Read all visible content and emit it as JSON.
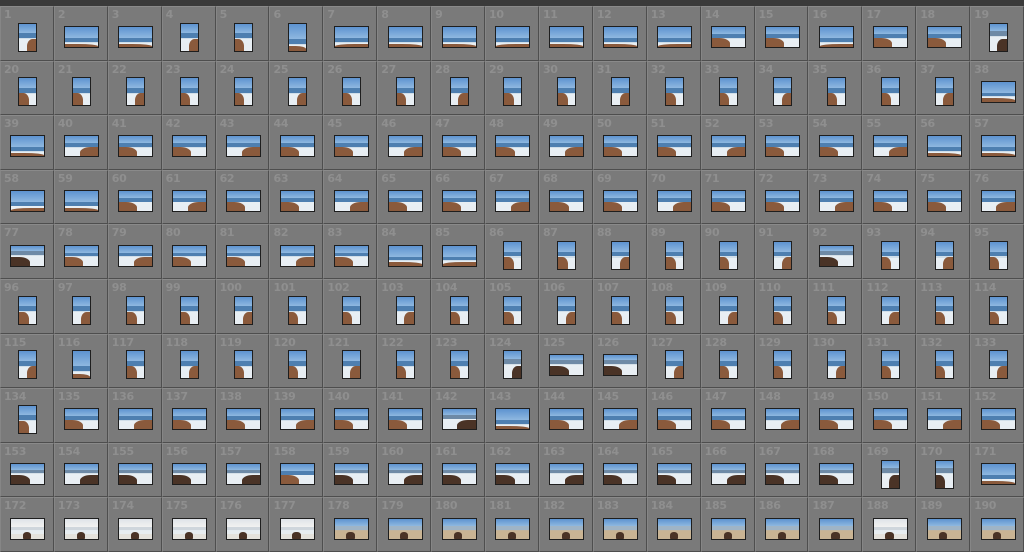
{
  "grid": {
    "columns": 19,
    "rows": 10,
    "first_number": 1,
    "last_number": 190,
    "thumbnails": [
      {
        "n": 1,
        "o": "portrait",
        "s": "coast"
      },
      {
        "n": 2,
        "o": "landscape",
        "s": "ocean"
      },
      {
        "n": 3,
        "o": "landscape",
        "s": "ocean"
      },
      {
        "n": 4,
        "o": "portrait",
        "s": "coast"
      },
      {
        "n": 5,
        "o": "portrait",
        "s": "coast"
      },
      {
        "n": 6,
        "o": "portrait",
        "s": "ocean"
      },
      {
        "n": 7,
        "o": "landscape",
        "s": "ocean"
      },
      {
        "n": 8,
        "o": "landscape",
        "s": "ocean"
      },
      {
        "n": 9,
        "o": "landscape",
        "s": "ocean"
      },
      {
        "n": 10,
        "o": "landscape",
        "s": "ocean"
      },
      {
        "n": 11,
        "o": "landscape",
        "s": "ocean"
      },
      {
        "n": 12,
        "o": "landscape",
        "s": "ocean"
      },
      {
        "n": 13,
        "o": "landscape",
        "s": "ocean"
      },
      {
        "n": 14,
        "o": "landscape",
        "s": "coast"
      },
      {
        "n": 15,
        "o": "landscape",
        "s": "coast"
      },
      {
        "n": 16,
        "o": "landscape",
        "s": "ocean"
      },
      {
        "n": 17,
        "o": "landscape",
        "s": "coast"
      },
      {
        "n": 18,
        "o": "landscape",
        "s": "coast"
      },
      {
        "n": 19,
        "o": "portrait",
        "s": "dark"
      },
      {
        "n": 20,
        "o": "portrait",
        "s": "coast"
      },
      {
        "n": 21,
        "o": "portrait",
        "s": "coast"
      },
      {
        "n": 22,
        "o": "portrait",
        "s": "coast"
      },
      {
        "n": 23,
        "o": "portrait",
        "s": "coast"
      },
      {
        "n": 24,
        "o": "portrait",
        "s": "coast"
      },
      {
        "n": 25,
        "o": "portrait",
        "s": "coast"
      },
      {
        "n": 26,
        "o": "portrait",
        "s": "coast"
      },
      {
        "n": 27,
        "o": "portrait",
        "s": "coast"
      },
      {
        "n": 28,
        "o": "portrait",
        "s": "coast"
      },
      {
        "n": 29,
        "o": "portrait",
        "s": "coast"
      },
      {
        "n": 30,
        "o": "portrait",
        "s": "coast"
      },
      {
        "n": 31,
        "o": "portrait",
        "s": "coast"
      },
      {
        "n": 32,
        "o": "portrait",
        "s": "coast"
      },
      {
        "n": 33,
        "o": "portrait",
        "s": "coast"
      },
      {
        "n": 34,
        "o": "portrait",
        "s": "coast"
      },
      {
        "n": 35,
        "o": "portrait",
        "s": "coast"
      },
      {
        "n": 36,
        "o": "portrait",
        "s": "coast"
      },
      {
        "n": 37,
        "o": "portrait",
        "s": "coast"
      },
      {
        "n": 38,
        "o": "landscape",
        "s": "ocean"
      },
      {
        "n": 39,
        "o": "landscape",
        "s": "ocean"
      },
      {
        "n": 40,
        "o": "landscape",
        "s": "coast"
      },
      {
        "n": 41,
        "o": "landscape",
        "s": "coast"
      },
      {
        "n": 42,
        "o": "landscape",
        "s": "coast"
      },
      {
        "n": 43,
        "o": "landscape",
        "s": "coast"
      },
      {
        "n": 44,
        "o": "landscape",
        "s": "coast"
      },
      {
        "n": 45,
        "o": "landscape",
        "s": "coast"
      },
      {
        "n": 46,
        "o": "landscape",
        "s": "coast"
      },
      {
        "n": 47,
        "o": "landscape",
        "s": "coast"
      },
      {
        "n": 48,
        "o": "landscape",
        "s": "coast"
      },
      {
        "n": 49,
        "o": "landscape",
        "s": "coast"
      },
      {
        "n": 50,
        "o": "landscape",
        "s": "coast"
      },
      {
        "n": 51,
        "o": "landscape",
        "s": "coast"
      },
      {
        "n": 52,
        "o": "landscape",
        "s": "coast"
      },
      {
        "n": 53,
        "o": "landscape",
        "s": "coast"
      },
      {
        "n": 54,
        "o": "landscape",
        "s": "coast"
      },
      {
        "n": 55,
        "o": "landscape",
        "s": "coast"
      },
      {
        "n": 56,
        "o": "landscape",
        "s": "ocean"
      },
      {
        "n": 57,
        "o": "landscape",
        "s": "ocean"
      },
      {
        "n": 58,
        "o": "landscape",
        "s": "ocean"
      },
      {
        "n": 59,
        "o": "landscape",
        "s": "ocean"
      },
      {
        "n": 60,
        "o": "landscape",
        "s": "coast"
      },
      {
        "n": 61,
        "o": "landscape",
        "s": "coast"
      },
      {
        "n": 62,
        "o": "landscape",
        "s": "coast"
      },
      {
        "n": 63,
        "o": "landscape",
        "s": "coast"
      },
      {
        "n": 64,
        "o": "landscape",
        "s": "coast"
      },
      {
        "n": 65,
        "o": "landscape",
        "s": "coast"
      },
      {
        "n": 66,
        "o": "landscape",
        "s": "coast"
      },
      {
        "n": 67,
        "o": "landscape",
        "s": "coast"
      },
      {
        "n": 68,
        "o": "landscape",
        "s": "coast"
      },
      {
        "n": 69,
        "o": "landscape",
        "s": "coast"
      },
      {
        "n": 70,
        "o": "landscape",
        "s": "coast"
      },
      {
        "n": 71,
        "o": "landscape",
        "s": "coast"
      },
      {
        "n": 72,
        "o": "landscape",
        "s": "coast"
      },
      {
        "n": 73,
        "o": "landscape",
        "s": "coast"
      },
      {
        "n": 74,
        "o": "landscape",
        "s": "coast"
      },
      {
        "n": 75,
        "o": "landscape",
        "s": "coast"
      },
      {
        "n": 76,
        "o": "landscape",
        "s": "coast"
      },
      {
        "n": 77,
        "o": "landscape",
        "s": "dark"
      },
      {
        "n": 78,
        "o": "landscape",
        "s": "coast"
      },
      {
        "n": 79,
        "o": "landscape",
        "s": "coast"
      },
      {
        "n": 80,
        "o": "landscape",
        "s": "coast"
      },
      {
        "n": 81,
        "o": "landscape",
        "s": "coast"
      },
      {
        "n": 82,
        "o": "landscape",
        "s": "coast"
      },
      {
        "n": 83,
        "o": "landscape",
        "s": "coast"
      },
      {
        "n": 84,
        "o": "landscape",
        "s": "ocean"
      },
      {
        "n": 85,
        "o": "landscape",
        "s": "ocean"
      },
      {
        "n": 86,
        "o": "portrait",
        "s": "coast"
      },
      {
        "n": 87,
        "o": "portrait",
        "s": "coast"
      },
      {
        "n": 88,
        "o": "portrait",
        "s": "coast"
      },
      {
        "n": 89,
        "o": "portrait",
        "s": "coast"
      },
      {
        "n": 90,
        "o": "portrait",
        "s": "coast"
      },
      {
        "n": 91,
        "o": "portrait",
        "s": "coast"
      },
      {
        "n": 92,
        "o": "landscape",
        "s": "dark"
      },
      {
        "n": 93,
        "o": "portrait",
        "s": "coast"
      },
      {
        "n": 94,
        "o": "portrait",
        "s": "coast"
      },
      {
        "n": 95,
        "o": "portrait",
        "s": "coast"
      },
      {
        "n": 96,
        "o": "portrait",
        "s": "coast"
      },
      {
        "n": 97,
        "o": "portrait",
        "s": "coast"
      },
      {
        "n": 98,
        "o": "portrait",
        "s": "coast"
      },
      {
        "n": 99,
        "o": "portrait",
        "s": "coast"
      },
      {
        "n": 100,
        "o": "portrait",
        "s": "coast"
      },
      {
        "n": 101,
        "o": "portrait",
        "s": "coast"
      },
      {
        "n": 102,
        "o": "portrait",
        "s": "coast"
      },
      {
        "n": 103,
        "o": "portrait",
        "s": "coast"
      },
      {
        "n": 104,
        "o": "portrait",
        "s": "coast"
      },
      {
        "n": 105,
        "o": "portrait",
        "s": "coast"
      },
      {
        "n": 106,
        "o": "portrait",
        "s": "coast"
      },
      {
        "n": 107,
        "o": "portrait",
        "s": "coast"
      },
      {
        "n": 108,
        "o": "portrait",
        "s": "coast"
      },
      {
        "n": 109,
        "o": "portrait",
        "s": "coast"
      },
      {
        "n": 110,
        "o": "portrait",
        "s": "coast"
      },
      {
        "n": 111,
        "o": "portrait",
        "s": "coast"
      },
      {
        "n": 112,
        "o": "portrait",
        "s": "coast"
      },
      {
        "n": 113,
        "o": "portrait",
        "s": "coast"
      },
      {
        "n": 114,
        "o": "portrait",
        "s": "coast"
      },
      {
        "n": 115,
        "o": "portrait",
        "s": "coast"
      },
      {
        "n": 116,
        "o": "portrait",
        "s": "ocean"
      },
      {
        "n": 117,
        "o": "portrait",
        "s": "coast"
      },
      {
        "n": 118,
        "o": "portrait",
        "s": "coast"
      },
      {
        "n": 119,
        "o": "portrait",
        "s": "coast"
      },
      {
        "n": 120,
        "o": "portrait",
        "s": "coast"
      },
      {
        "n": 121,
        "o": "portrait",
        "s": "coast"
      },
      {
        "n": 122,
        "o": "portrait",
        "s": "coast"
      },
      {
        "n": 123,
        "o": "portrait",
        "s": "coast"
      },
      {
        "n": 124,
        "o": "portrait",
        "s": "dark"
      },
      {
        "n": 125,
        "o": "landscape",
        "s": "dark"
      },
      {
        "n": 126,
        "o": "landscape",
        "s": "dark"
      },
      {
        "n": 127,
        "o": "portrait",
        "s": "coast"
      },
      {
        "n": 128,
        "o": "portrait",
        "s": "coast"
      },
      {
        "n": 129,
        "o": "portrait",
        "s": "coast"
      },
      {
        "n": 130,
        "o": "portrait",
        "s": "coast"
      },
      {
        "n": 131,
        "o": "portrait",
        "s": "coast"
      },
      {
        "n": 132,
        "o": "portrait",
        "s": "coast"
      },
      {
        "n": 133,
        "o": "portrait",
        "s": "coast"
      },
      {
        "n": 134,
        "o": "portrait",
        "s": "coast"
      },
      {
        "n": 135,
        "o": "landscape",
        "s": "coast"
      },
      {
        "n": 136,
        "o": "landscape",
        "s": "coast"
      },
      {
        "n": 137,
        "o": "landscape",
        "s": "coast"
      },
      {
        "n": 138,
        "o": "landscape",
        "s": "coast"
      },
      {
        "n": 139,
        "o": "landscape",
        "s": "coast"
      },
      {
        "n": 140,
        "o": "landscape",
        "s": "coast"
      },
      {
        "n": 141,
        "o": "landscape",
        "s": "coast"
      },
      {
        "n": 142,
        "o": "landscape",
        "s": "dark"
      },
      {
        "n": 143,
        "o": "landscape",
        "s": "ocean"
      },
      {
        "n": 144,
        "o": "landscape",
        "s": "coast"
      },
      {
        "n": 145,
        "o": "landscape",
        "s": "coast"
      },
      {
        "n": 146,
        "o": "landscape",
        "s": "coast"
      },
      {
        "n": 147,
        "o": "landscape",
        "s": "coast"
      },
      {
        "n": 148,
        "o": "landscape",
        "s": "coast"
      },
      {
        "n": 149,
        "o": "landscape",
        "s": "coast"
      },
      {
        "n": 150,
        "o": "landscape",
        "s": "coast"
      },
      {
        "n": 151,
        "o": "landscape",
        "s": "coast"
      },
      {
        "n": 152,
        "o": "landscape",
        "s": "coast"
      },
      {
        "n": 153,
        "o": "landscape",
        "s": "dark"
      },
      {
        "n": 154,
        "o": "landscape",
        "s": "dark"
      },
      {
        "n": 155,
        "o": "landscape",
        "s": "dark"
      },
      {
        "n": 156,
        "o": "landscape",
        "s": "dark"
      },
      {
        "n": 157,
        "o": "landscape",
        "s": "dark"
      },
      {
        "n": 158,
        "o": "landscape",
        "s": "coast"
      },
      {
        "n": 159,
        "o": "landscape",
        "s": "dark"
      },
      {
        "n": 160,
        "o": "landscape",
        "s": "dark"
      },
      {
        "n": 161,
        "o": "landscape",
        "s": "dark"
      },
      {
        "n": 162,
        "o": "landscape",
        "s": "dark"
      },
      {
        "n": 163,
        "o": "landscape",
        "s": "dark"
      },
      {
        "n": 164,
        "o": "landscape",
        "s": "dark"
      },
      {
        "n": 165,
        "o": "landscape",
        "s": "dark"
      },
      {
        "n": 166,
        "o": "landscape",
        "s": "dark"
      },
      {
        "n": 167,
        "o": "landscape",
        "s": "dark"
      },
      {
        "n": 168,
        "o": "landscape",
        "s": "dark"
      },
      {
        "n": 169,
        "o": "portrait",
        "s": "dark"
      },
      {
        "n": 170,
        "o": "portrait",
        "s": "dark"
      },
      {
        "n": 171,
        "o": "landscape",
        "s": "ocean"
      },
      {
        "n": 172,
        "o": "landscape",
        "s": "beach"
      },
      {
        "n": 173,
        "o": "landscape",
        "s": "beach"
      },
      {
        "n": 174,
        "o": "landscape",
        "s": "beach"
      },
      {
        "n": 175,
        "o": "landscape",
        "s": "beach"
      },
      {
        "n": 176,
        "o": "landscape",
        "s": "beach"
      },
      {
        "n": 177,
        "o": "landscape",
        "s": "beach"
      },
      {
        "n": 178,
        "o": "landscape",
        "s": "sand"
      },
      {
        "n": 179,
        "o": "landscape",
        "s": "sand"
      },
      {
        "n": 180,
        "o": "landscape",
        "s": "sand"
      },
      {
        "n": 181,
        "o": "landscape",
        "s": "sand"
      },
      {
        "n": 182,
        "o": "landscape",
        "s": "sand"
      },
      {
        "n": 183,
        "o": "landscape",
        "s": "sand"
      },
      {
        "n": 184,
        "o": "landscape",
        "s": "sand"
      },
      {
        "n": 185,
        "o": "landscape",
        "s": "sand"
      },
      {
        "n": 186,
        "o": "landscape",
        "s": "sand"
      },
      {
        "n": 187,
        "o": "landscape",
        "s": "sand"
      },
      {
        "n": 188,
        "o": "landscape",
        "s": "beach"
      },
      {
        "n": 189,
        "o": "landscape",
        "s": "sand"
      },
      {
        "n": 190,
        "o": "landscape",
        "s": "sand"
      }
    ]
  },
  "palette": {
    "cell_bg": "#7a7a7a",
    "number_color": "#8f8f8f",
    "sky": "#8fb8e0",
    "sky_top": "#5d93d0",
    "sea": "#4e7fb0",
    "rock": "#8a5a3c",
    "rock_dark": "#4a3326",
    "foam": "#e8eef3",
    "sand": "#c9b494",
    "dark": "#2a2d33"
  }
}
